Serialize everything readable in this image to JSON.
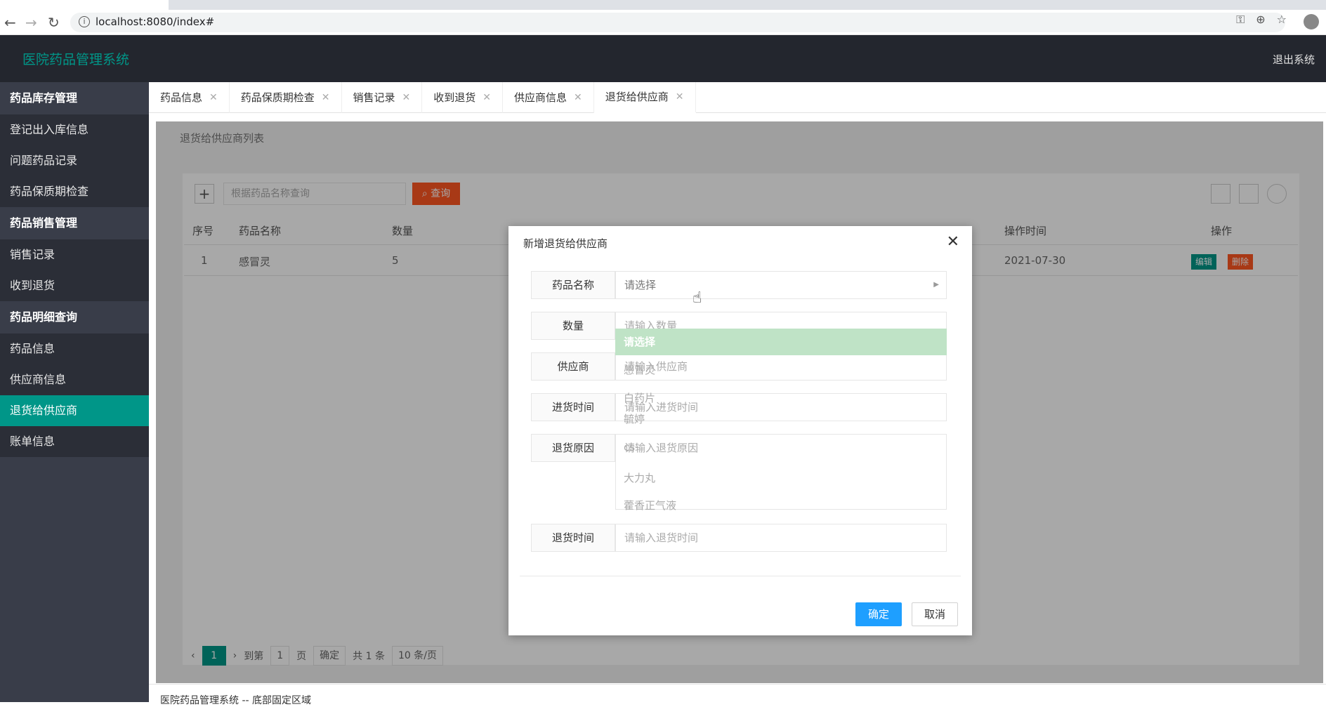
{
  "browser": {
    "url": "localhost:8080/index#"
  },
  "header": {
    "title": "医院药品管理系统",
    "logout": "退出系统"
  },
  "sidebar": {
    "groups": [
      {
        "label": "药品库存管理",
        "items": [
          "登记出入库信息",
          "问题药品记录",
          "药品保质期检查"
        ]
      },
      {
        "label": "药品销售管理",
        "items": [
          "销售记录",
          "收到退货"
        ]
      },
      {
        "label": "药品明细查询",
        "items": [
          "药品信息",
          "供应商信息",
          "退货给供应商",
          "账单信息"
        ]
      }
    ],
    "active": "退货给供应商"
  },
  "tabs": [
    "药品信息",
    "药品保质期检查",
    "销售记录",
    "收到退货",
    "供应商信息",
    "退货给供应商"
  ],
  "list": {
    "title": "退货给供应商列表",
    "search_placeholder": "根据药品名称查询",
    "search_button": "查询",
    "columns": {
      "no": "序号",
      "name": "药品名称",
      "qty": "数量",
      "time": "操作时间",
      "op": "操作"
    },
    "rows": [
      {
        "no": "1",
        "name": "感冒灵",
        "qty": "5",
        "time": "2021-07-30"
      }
    ],
    "edit": "编辑",
    "delete": "删除"
  },
  "pager": {
    "current": "1",
    "goto": "到第",
    "page_input": "1",
    "page_unit": "页",
    "confirm": "确定",
    "total": "共 1 条",
    "page_size": "10 条/页"
  },
  "footer": "医院药品管理系统 -- 底部固定区域",
  "dialog": {
    "title": "新增退货给供应商",
    "fields": {
      "drug": {
        "label": "药品名称",
        "placeholder": "请选择"
      },
      "qty": {
        "label": "数量",
        "placeholder": "请输入数量"
      },
      "supplier": {
        "label": "供应商",
        "placeholder": "请输入供应商"
      },
      "intime": {
        "label": "进货时间",
        "placeholder": "请输入进货时间"
      },
      "reason": {
        "label": "退货原因",
        "placeholder": "请输入退货原因"
      },
      "rtime": {
        "label": "退货时间",
        "placeholder": "请输入退货时间"
      }
    },
    "ok": "确定",
    "cancel": "取消",
    "dropdown": [
      "请选择",
      "感冒灵",
      "白药片",
      "毓婷",
      "cs",
      "大力丸",
      "藿香正气液"
    ]
  }
}
